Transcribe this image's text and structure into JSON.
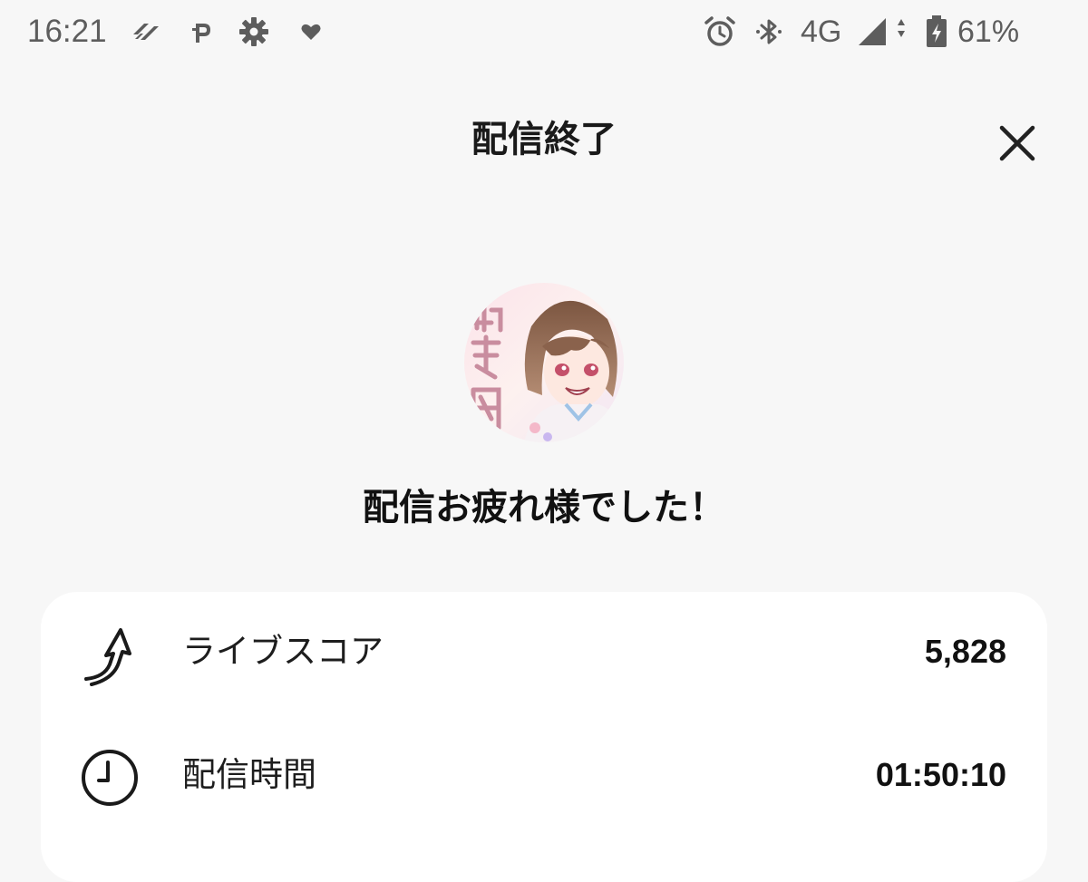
{
  "status_bar": {
    "time": "16:21",
    "left_icons": [
      "streaming-app-icon",
      "parking-app-icon",
      "settings-gear-icon",
      "heart-icon"
    ],
    "right_icons": [
      "alarm-clock-icon",
      "bluetooth-icon",
      "cellular-signal-icon",
      "battery-charging-icon"
    ],
    "network": "4G",
    "battery": "61%"
  },
  "header": {
    "title": "配信終了",
    "close_icon": "close-icon"
  },
  "avatar": {
    "icon": "user-avatar"
  },
  "message": "配信お疲れ様でした！",
  "stats": [
    {
      "icon": "live-score-icon",
      "label": "ライブスコア",
      "value": "5,828"
    },
    {
      "icon": "clock-icon",
      "label": "配信時間",
      "value": "01:50:10"
    }
  ],
  "colors": {
    "background": "#f7f7f7",
    "card": "#ffffff",
    "text": "#111111",
    "status_text": "#5d5d5d"
  }
}
